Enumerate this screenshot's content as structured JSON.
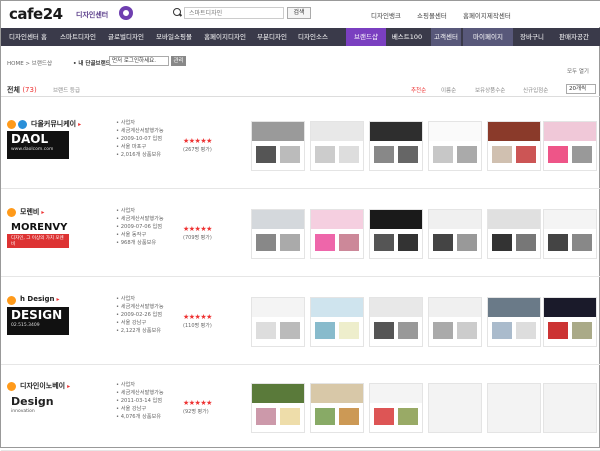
{
  "header": {
    "logo": "cafe24",
    "logo_sub": "디자인센터",
    "search_placeholder": "스마트디자인",
    "search_button": "검색",
    "links": [
      "디자인뱅크",
      "쇼핑몰센터",
      "홈페이지제작센터"
    ]
  },
  "nav": {
    "items": [
      "디자인센터 홈",
      "스마트디자인",
      "글로벌디자인",
      "모바일쇼핑몰",
      "홈페이지디자인",
      "부분디자인",
      "디자인소스",
      "브랜드샵",
      "베스트100",
      "고객센터",
      "마이페이지",
      "장바구니",
      "판매자공간"
    ],
    "active_index": 7
  },
  "breadcrumb": {
    "path": "HOME > 브랜드샵",
    "my_brand_label": "• 내 단골브랜드",
    "select_value": "먼저 로그인하세요.",
    "apply_button": "관리",
    "close_all": "모두 열기"
  },
  "tabs": {
    "all_label": "전체",
    "all_count": "(73)",
    "rank_label": "브랜드 등급",
    "sorts": [
      "추천순",
      "이름순",
      "보유상품수순",
      "신규입점순"
    ],
    "per_page": "20개씩"
  },
  "vendors": [
    {
      "name": "다올커뮤니케이",
      "info": [
        "사업자",
        "세금계산서발행가능",
        "2009-10-07 입점",
        "서울 마포구",
        "2,016개 상품보유"
      ],
      "stars": "★★★★★",
      "reviews": "(267명 평가)",
      "logo_text": "DAOL",
      "logo_url": "www.daolcom.com",
      "badge_colors": [
        "#ff9a1a",
        "#2a8fd8"
      ],
      "thumb_colors": [
        [
          "#9a9a9a",
          "#555",
          "#bbb"
        ],
        [
          "#e8e8e8",
          "#ccc",
          "#ddd"
        ],
        [
          "#2e2e2e",
          "#888",
          "#666"
        ],
        [
          "#fafafa",
          "#c7c7c7",
          "#aaa"
        ],
        [
          "#8a3a2a",
          "#d0c0b0",
          "#c55"
        ],
        [
          "#f0c8d8",
          "#e58",
          "#999"
        ]
      ]
    },
    {
      "name": "모렌비",
      "info": [
        "사업자",
        "세금계산서발행가능",
        "2009-07-06 입점",
        "서울 동작구",
        "968개 상품보유"
      ],
      "stars": "★★★★★",
      "reviews": "(709명 평가)",
      "logo_text": "MORENVY",
      "logo_url": "디자인, 그 이상의 가치 모렌비",
      "badge_colors": [
        "#ff9a1a"
      ],
      "thumb_colors": [
        [
          "#d4d8dc",
          "#888",
          "#aaa"
        ],
        [
          "#f5cfe0",
          "#e6a",
          "#c89"
        ],
        [
          "#1a1a1a",
          "#555",
          "#333"
        ],
        [
          "#f0f0f0",
          "#444",
          "#999"
        ],
        [
          "#e0e0e0",
          "#333",
          "#777"
        ],
        [
          "#f4f4f4",
          "#444",
          "#888"
        ]
      ]
    },
    {
      "name": "h Design",
      "info": [
        "사업자",
        "세금계산서발행가능",
        "2009-02-26 입점",
        "서울 강남구",
        "2,122개 상품보유"
      ],
      "stars": "★★★★★",
      "reviews": "(110명 평가)",
      "logo_text": "DESIGN",
      "logo_url": "02.515.3409",
      "badge_colors": [
        "#ff9a1a"
      ],
      "thumb_colors": [
        [
          "#f4f4f4",
          "#ddd",
          "#bbb"
        ],
        [
          "#cfe4ee",
          "#8bc",
          "#eec"
        ],
        [
          "#e8e8e8",
          "#555",
          "#999"
        ],
        [
          "#f0f0f0",
          "#aaa",
          "#ccc"
        ],
        [
          "#6a7a88",
          "#abc",
          "#ddd"
        ],
        [
          "#1a1a2a",
          "#c33",
          "#aa8"
        ]
      ]
    },
    {
      "name": "디자인이노베이",
      "info": [
        "사업자",
        "세금계산서발행가능",
        "2011-03-14 입점",
        "서울 강남구",
        "4,076개 상품보유"
      ],
      "stars": "★★★★★",
      "reviews": "(92명 평가)",
      "logo_text": "Design",
      "logo_url": "innovation",
      "badge_colors": [
        "#ff9a1a"
      ],
      "thumb_colors": [
        [
          "#5a7a3a",
          "#c9a",
          "#eda"
        ],
        [
          "#d8c8a8",
          "#8a6",
          "#c95"
        ],
        [
          "#f4f4f4",
          "#d55",
          "#9a6"
        ],
        [
          "",
          ""
        ],
        [
          "",
          ""
        ],
        [
          "",
          ""
        ]
      ]
    }
  ]
}
